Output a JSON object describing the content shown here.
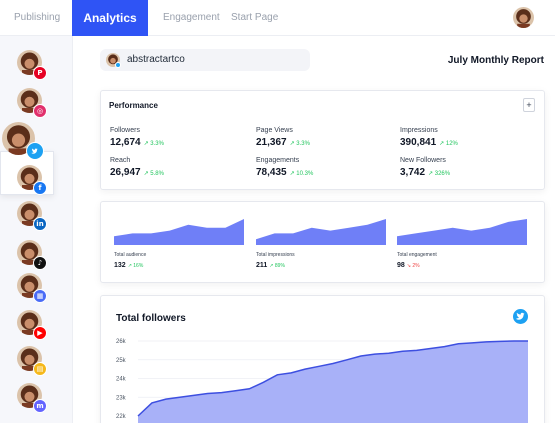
{
  "nav": {
    "tabs": [
      {
        "label": "Publishing",
        "active": false
      },
      {
        "label": "Analytics",
        "active": true
      },
      {
        "label": "Engagement",
        "active": false
      },
      {
        "label": "Start Page",
        "active": false
      }
    ]
  },
  "sidebar": {
    "accounts": [
      {
        "network": "pinterest",
        "color": "#e60023",
        "glyph": "P",
        "selected": false
      },
      {
        "network": "instagram",
        "color": "#e1306c",
        "glyph": "◎",
        "selected": false
      },
      {
        "network": "twitter",
        "color": "#1da1f2",
        "glyph": "",
        "selected": true
      },
      {
        "network": "facebook",
        "color": "#1877f2",
        "glyph": "f",
        "selected": false
      },
      {
        "network": "linkedin",
        "color": "#0a66c2",
        "glyph": "in",
        "selected": false
      },
      {
        "network": "tiktok",
        "color": "#111111",
        "glyph": "♪",
        "selected": false
      },
      {
        "network": "google-business",
        "color": "#4a6cf7",
        "glyph": "▦",
        "selected": false
      },
      {
        "network": "youtube",
        "color": "#ff0000",
        "glyph": "▶",
        "selected": false
      },
      {
        "network": "start-page",
        "color": "#f5b81b",
        "glyph": "▤",
        "selected": false
      },
      {
        "network": "mastodon",
        "color": "#6364ff",
        "glyph": "m",
        "selected": false
      }
    ]
  },
  "header": {
    "account_name": "abstractartco",
    "report_title": "July Monthly Report"
  },
  "performance": {
    "title": "Performance",
    "add_label": "+",
    "metrics": [
      {
        "label": "Followers",
        "value": "12,674",
        "change": "3.3%"
      },
      {
        "label": "Page Views",
        "value": "21,367",
        "change": "3.3%"
      },
      {
        "label": "Impressions",
        "value": "390,841",
        "change": "12%"
      },
      {
        "label": "Reach",
        "value": "26,947",
        "change": "5.8%"
      },
      {
        "label": "Engagements",
        "value": "78,435",
        "change": "10.3%"
      },
      {
        "label": "New Followers",
        "value": "3,742",
        "change": "326%"
      }
    ]
  },
  "sparklines": [
    {
      "label": "Total audience",
      "value": "132",
      "change": "16%",
      "direction": "up",
      "points": [
        3,
        4,
        4,
        5,
        7,
        6,
        6,
        9
      ]
    },
    {
      "label": "Total impressions",
      "value": "211",
      "change": "89%",
      "direction": "up",
      "points": [
        2,
        4,
        4,
        6,
        5,
        6,
        7,
        9
      ]
    },
    {
      "label": "Total engagement",
      "value": "98",
      "change": "2%",
      "direction": "down",
      "points": [
        3,
        4,
        5,
        6,
        5,
        6,
        8,
        9
      ]
    }
  ],
  "total_followers": {
    "title": "Total followers",
    "chart_data": {
      "type": "area",
      "title": "Total followers",
      "y_ticks": [
        "26k",
        "25k",
        "24k",
        "23k",
        "22k"
      ],
      "ylim": [
        22000,
        26000
      ],
      "grid": true,
      "color": "#6f7ff7",
      "values": [
        22000,
        22700,
        22900,
        23000,
        23100,
        23200,
        23250,
        23350,
        23450,
        23800,
        24200,
        24300,
        24500,
        24650,
        24800,
        25000,
        25200,
        25300,
        25350,
        25450,
        25500,
        25600,
        25700,
        25850,
        25900,
        25950,
        25980,
        26000,
        26000
      ]
    }
  },
  "colors": {
    "accent": "#2f54f5",
    "chart_fill": "#6f7ff7",
    "positive": "#22c55e",
    "negative": "#ef4444"
  }
}
